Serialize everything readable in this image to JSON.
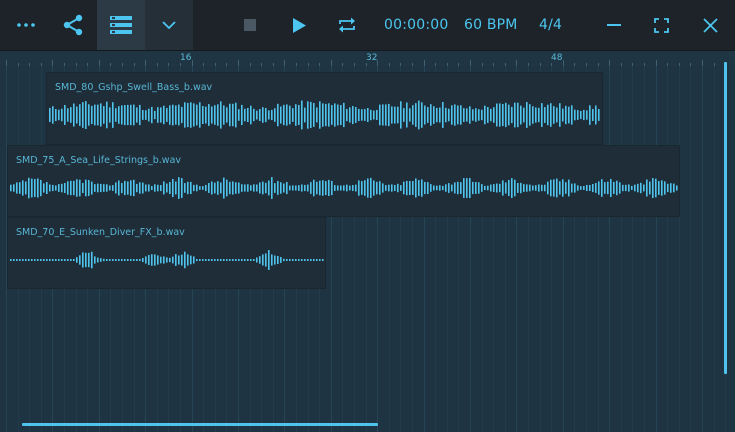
{
  "toolbar": {
    "more_icon": "more-horizontal-icon",
    "share_icon": "share-icon",
    "tracks_icon": "tracks-list-icon",
    "expand_icon": "chevron-down-icon",
    "stop_icon": "stop-icon",
    "play_icon": "play-icon",
    "loop_icon": "loop-icon",
    "time": "00:00:00",
    "tempo": "60 BPM",
    "time_signature": "4/4",
    "minimize_icon": "minimize-icon",
    "fullscreen_icon": "fullscreen-icon",
    "close_icon": "close-icon",
    "accent": "#4cc6f0"
  },
  "ruler": {
    "markers": [
      "16",
      "32",
      "48"
    ]
  },
  "clips": [
    {
      "name": "SMD_80_Gshp_Swell_Bass_b.wav"
    },
    {
      "name": "SMD_75_A_Sea_Life_Strings_b.wav"
    },
    {
      "name": "SMD_70_E_Sunken_Diver_FX_b.wav"
    }
  ]
}
